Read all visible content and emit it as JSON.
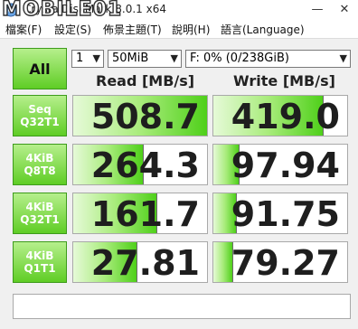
{
  "window": {
    "title": "CrystalDiskMark 8.0.1 x64",
    "watermark": "MOBILE01",
    "minimize_glyph": "—",
    "close_glyph": "✕"
  },
  "menu": [
    {
      "label": "檔案(F)"
    },
    {
      "label": "設定(S)"
    },
    {
      "label": "佈景主題(T)"
    },
    {
      "label": "說明(H)"
    },
    {
      "label": "語言(Language)"
    }
  ],
  "controls": {
    "all_label": "All",
    "count": "1",
    "size": "50MiB",
    "drive": "F: 0% (0/238GiB)"
  },
  "headers": {
    "read": "Read [MB/s]",
    "write": "Write [MB/s]"
  },
  "rows": [
    {
      "line1": "Seq",
      "line2": "Q32T1",
      "read": "508.7",
      "write": "419.0",
      "read_fill": 1.0,
      "write_fill": 0.82
    },
    {
      "line1": "4KiB",
      "line2": "Q8T8",
      "read": "264.3",
      "write": "97.94",
      "read_fill": 0.52,
      "write_fill": 0.19
    },
    {
      "line1": "4KiB",
      "line2": "Q32T1",
      "read": "161.7",
      "write": "91.75",
      "read_fill": 0.62,
      "write_fill": 0.17
    },
    {
      "line1": "4KiB",
      "line2": "Q1T1",
      "read": "27.81",
      "write": "79.27",
      "read_fill": 0.47,
      "write_fill": 0.14
    }
  ],
  "comment": "",
  "colors": {
    "accent_green": "#5fcd25",
    "bar_light": "#e6fad8"
  }
}
